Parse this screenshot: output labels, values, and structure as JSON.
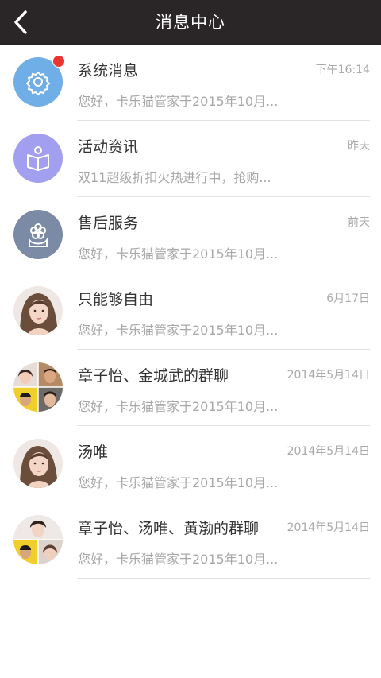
{
  "header": {
    "title": "消息中心"
  },
  "messages": [
    {
      "title": "系统消息",
      "time": "下午16:14",
      "preview": "您好，卡乐猫管家于2015年10月...",
      "avatar": "gear-icon",
      "avatar_color": "#6faee6",
      "unread": true
    },
    {
      "title": "活动资讯",
      "time": "昨天",
      "preview": "双11超级折扣火热进行中，抢购...",
      "avatar": "book-icon",
      "avatar_color": "#a39ff0",
      "unread": false
    },
    {
      "title": "售后服务",
      "time": "前天",
      "preview": "您好，卡乐猫管家于2015年10月...",
      "avatar": "flower-icon",
      "avatar_color": "#7b8ba6",
      "unread": false
    },
    {
      "title": "只能够自由",
      "time": "6月17日",
      "preview": "您好，卡乐猫管家于2015年10月...",
      "avatar": "user-photo",
      "unread": false
    },
    {
      "title": "章子怡、金城武的群聊",
      "time": "2014年5月14日",
      "preview": "您好，卡乐猫管家于2015年10月...",
      "avatar": "group-photo",
      "unread": false
    },
    {
      "title": "汤唯",
      "time": "2014年5月14日",
      "preview": "您好，卡乐猫管家于2015年10月...",
      "avatar": "user-photo",
      "unread": false
    },
    {
      "title": "章子怡、汤唯、黄渤的群聊",
      "time": "2014年5月14日",
      "preview": "您好，卡乐猫管家于2015年10月...",
      "avatar": "group-photo",
      "unread": false
    }
  ],
  "colors": {
    "header_bg": "#2a2627",
    "unread_dot": "#ee3333"
  }
}
